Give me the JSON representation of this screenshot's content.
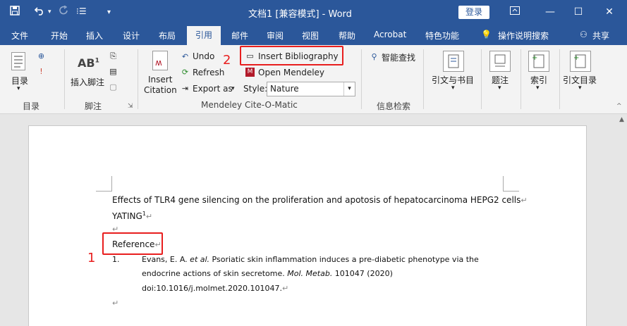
{
  "titlebar": {
    "title": "文档1 [兼容模式] - Word",
    "login": "登录",
    "save_icon": "save-icon",
    "undo_icon": "undo-icon",
    "redo_icon": "redo-icon"
  },
  "tabs": [
    "文件",
    "开始",
    "插入",
    "设计",
    "布局",
    "引用",
    "邮件",
    "审阅",
    "视图",
    "帮助",
    "Acrobat",
    "特色功能"
  ],
  "active_tab": "引用",
  "tell_me": "操作说明搜索",
  "share": "共享",
  "ribbon": {
    "toc": {
      "label": "目录",
      "group": "目录"
    },
    "footnote": {
      "label": "插入脚注",
      "group": "脚注"
    },
    "mendeley": {
      "insert_citation_line1": "Insert",
      "insert_citation_line2": "Citation",
      "undo": "Undo",
      "refresh": "Refresh",
      "export_as": "Export as",
      "insert_bibliography": "Insert Bibliography",
      "open_mendeley": "Open Mendeley",
      "style_label": "Style:",
      "style_value": "Nature",
      "group": "Mendeley Cite-O-Matic"
    },
    "smart_lookup": {
      "label": "智能查找",
      "group": "信息检索"
    },
    "citations": {
      "label": "引文与书目"
    },
    "captions": {
      "label": "题注"
    },
    "index": {
      "label": "索引"
    },
    "toa": {
      "label": "引文目录"
    }
  },
  "document": {
    "title_line": "Effects of TLR4 gene silencing on the proliferation and apotosis of hepatocarcinoma HEPG2 cells",
    "author": "YATING",
    "author_sup": "1",
    "reference_heading": "Reference",
    "ref_num": "1.",
    "ref_line1_pre": "Evans, E. A. ",
    "ref_line1_etal": "et al.",
    "ref_line1_post": " Psoriatic skin inflammation induces a pre-diabetic phenotype via the",
    "ref_line2_pre": "endocrine actions of skin secretome. ",
    "ref_line2_journal": "Mol. Metab.",
    "ref_line2_post": " 101047 (2020)",
    "ref_line3": "doi:10.1016/j.molmet.2020.101047."
  },
  "annotations": {
    "num1": "1",
    "num2": "2"
  },
  "colors": {
    "word_blue": "#2b579a",
    "annotation_red": "#e81e1e"
  }
}
